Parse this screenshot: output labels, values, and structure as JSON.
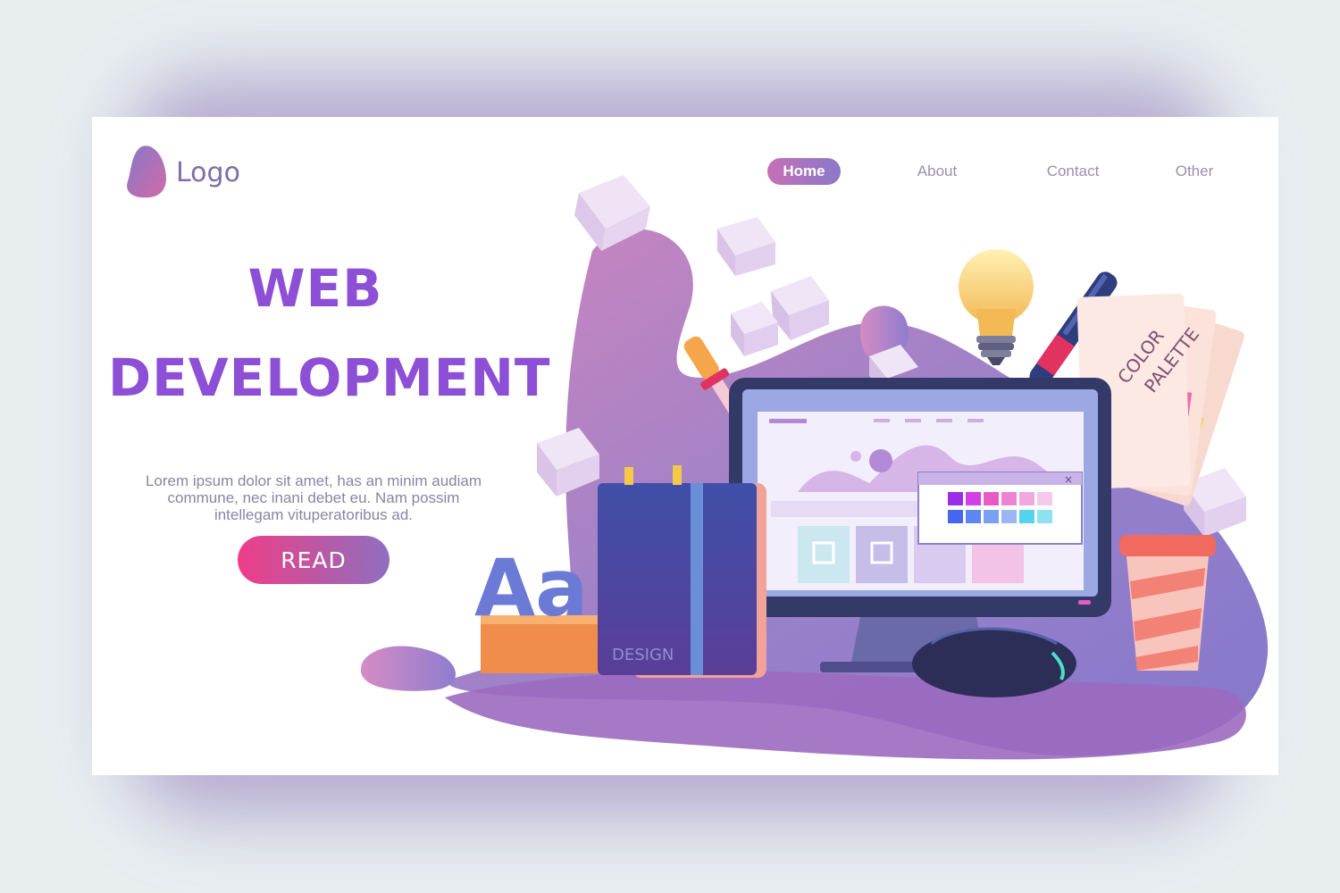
{
  "logo": {
    "text": "Logo"
  },
  "nav": {
    "items": [
      {
        "label": "Home",
        "active": true
      },
      {
        "label": "About",
        "active": false
      },
      {
        "label": "Contact",
        "active": false
      },
      {
        "label": "Other",
        "active": false
      }
    ]
  },
  "hero": {
    "headline_line1": "WEB",
    "headline_line2": "DEVELOPMENT",
    "body": "Lorem ipsum dolor sit amet, has an minim audiam commune, nec inani debet eu. Nam possim intellegam vituperatoribus ad.",
    "cta_label": "READ"
  },
  "illustration": {
    "book_label": "DESIGN",
    "palette_label_line1": "COLOR",
    "palette_label_line2": "PALETTE",
    "letters_label": "Aa",
    "popup_close": "×"
  },
  "colors": {
    "accent_purple": "#8c4fd6",
    "button_pink": "#ee3e87",
    "button_violet": "#8e6fbf",
    "background": "#e8eef0"
  }
}
